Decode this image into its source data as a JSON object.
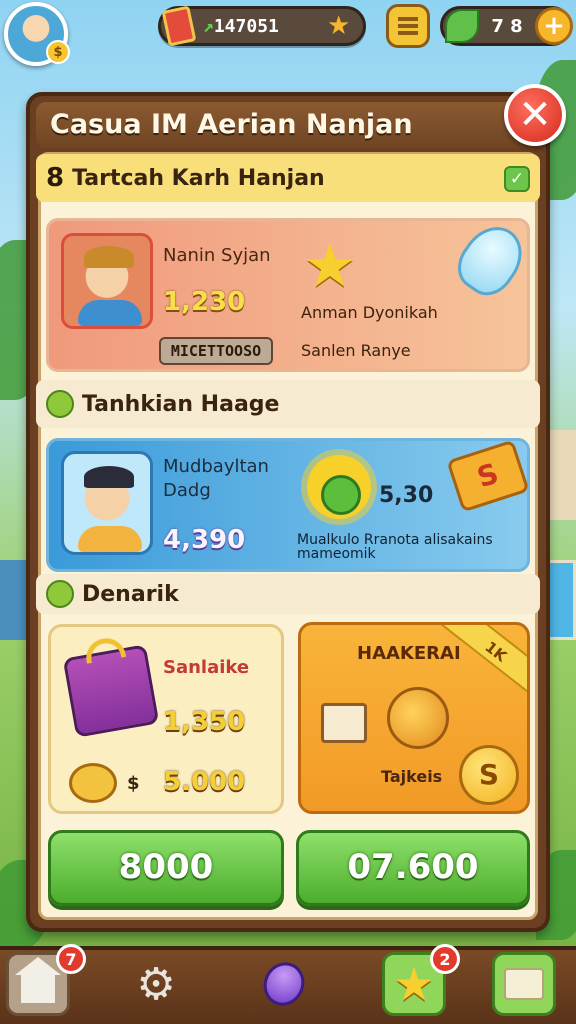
{
  "top_bar": {
    "profile_badge": "$",
    "coins": "147051",
    "coins_prefix": "↗",
    "gems": "7 8",
    "gems_plus": "+"
  },
  "panel": {
    "title": "Casua IM Aerian Nanjan",
    "close_glyph": "✕"
  },
  "section1": {
    "number": "8",
    "title": "Tartcah Karh Hanjan",
    "check_glyph": "✓"
  },
  "player_card": {
    "name": "Nanin Syjan",
    "score": "1,230",
    "tag": "MICETTOOSO",
    "subtitle1": "Anman Dyonikah",
    "subtitle2": "Sanlen Ranye"
  },
  "section2": {
    "title": "Tanhkian Haage"
  },
  "challenge_card": {
    "name": "Mudbayltan Dadg",
    "score": "4,390",
    "value": "5,30",
    "coin_glyph": "S",
    "description": "Mualkulo Rranota alisakains mameomik"
  },
  "section3": {
    "title": "Denarik"
  },
  "offer_left": {
    "title": "Sanlaike",
    "value1": "1,350",
    "currency": "$",
    "value2": "5.000",
    "button": "8000"
  },
  "offer_right": {
    "title": "HAAKERAI",
    "ribbon": "1K",
    "label": "Tajkeis",
    "badge": "S",
    "button": "07.600"
  },
  "bottom_nav": {
    "home_notifications": "7",
    "star_notifications": "2",
    "settings_glyph": "⚙",
    "star_glyph": "★"
  },
  "colors": {
    "panel_wood": "#6b3f22",
    "buy_green": "#4cad2e",
    "close_red": "#d42a1c",
    "section_yellow": "#f9df7a"
  }
}
